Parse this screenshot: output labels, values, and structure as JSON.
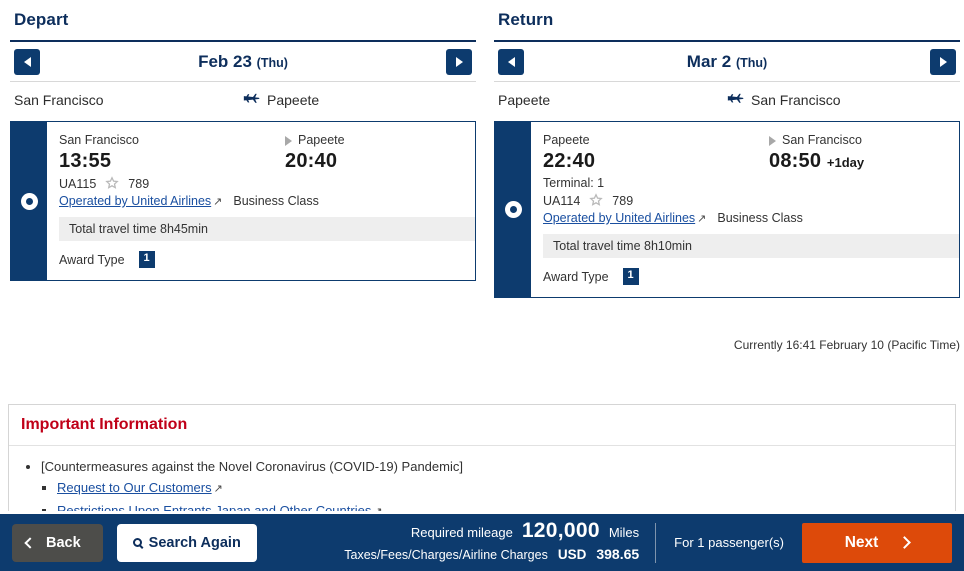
{
  "depart": {
    "title": "Depart",
    "prev_icon": "chevron-left-icon",
    "next_icon": "chevron-right-icon",
    "date": "Feb 23",
    "dow": "(Thu)",
    "route_from": "San Francisco",
    "route_to": "Papeete",
    "card": {
      "origin": "San Francisco",
      "destination": "Papeete",
      "depart_time": "13:55",
      "arrive_time": "20:40",
      "plus_day": "",
      "terminal": "",
      "flight_no": "UA115",
      "aircraft": "789",
      "operator": "Operated by United Airlines",
      "cabin": "Business Class",
      "travel_time": "Total travel time 8h45min",
      "award_label": "Award Type",
      "award_badge": "1"
    }
  },
  "return": {
    "title": "Return",
    "prev_icon": "chevron-left-icon",
    "next_icon": "chevron-right-icon",
    "date": "Mar 2",
    "dow": "(Thu)",
    "route_from": "Papeete",
    "route_to": "San Francisco",
    "card": {
      "origin": "Papeete",
      "destination": "San Francisco",
      "depart_time": "22:40",
      "arrive_time": "08:50",
      "plus_day": "+1day",
      "terminal": "Terminal: 1",
      "flight_no": "UA114",
      "aircraft": "789",
      "operator": "Operated by United Airlines",
      "cabin": "Business Class",
      "travel_time": "Total travel time 8h10min",
      "award_label": "Award Type",
      "award_badge": "1"
    }
  },
  "currently": "Currently 16:41 February 10 (Pacific Time)",
  "important": {
    "title": "Important Information",
    "item1": "[Countermeasures against the Novel Coronavirus (COVID-19) Pandemic]",
    "item2": "Request to Our Customers",
    "item3": "Restrictions Upon Entrants Japan and Other Countries"
  },
  "footer": {
    "back_label": "Back",
    "search_label": "Search Again",
    "required_mileage_label": "Required mileage",
    "miles_value": "120,000",
    "miles_unit": "Miles",
    "taxes_label": "Taxes/Fees/Charges/Airline Charges",
    "currency": "USD",
    "amount": "398.65",
    "passengers": "For 1 passenger(s)",
    "next_label": "Next"
  },
  "colors": {
    "navy": "#0d3b6e",
    "navy_dark": "#0d2e5c",
    "link": "#1a4fa0",
    "red": "#c00018",
    "orange": "#dd4a0a",
    "grey_band": "#eeeeee"
  }
}
